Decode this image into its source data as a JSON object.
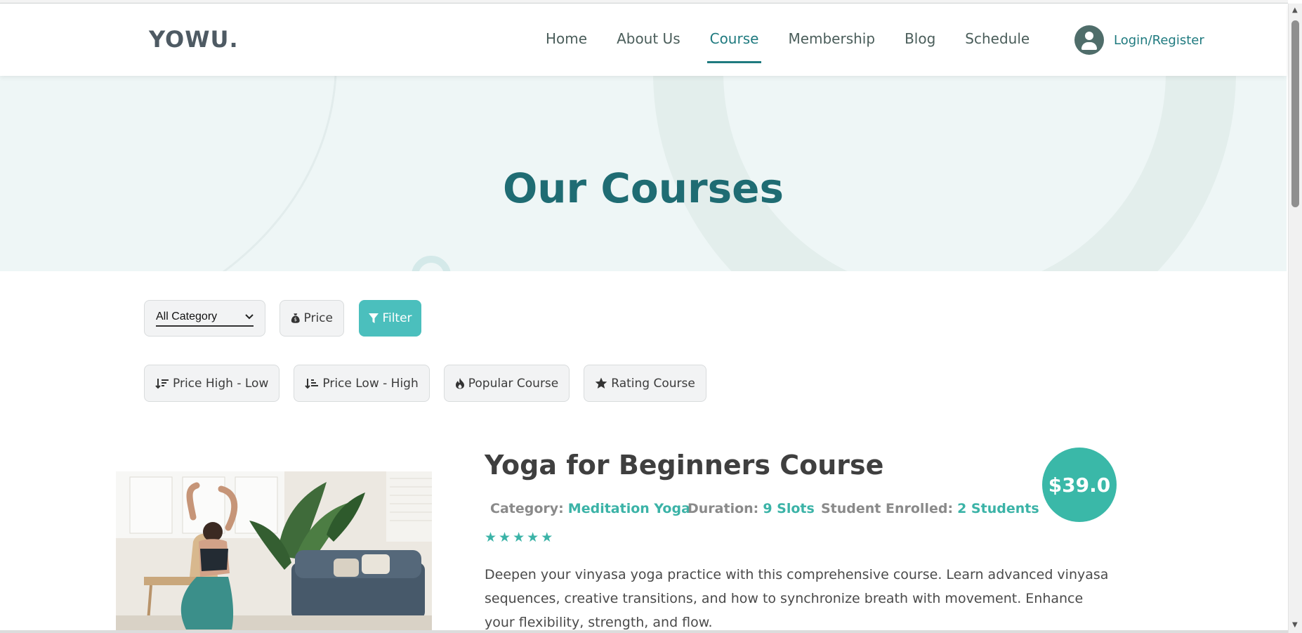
{
  "header": {
    "logo": "YOWU.",
    "nav": [
      {
        "label": "Home",
        "active": false
      },
      {
        "label": "About Us",
        "active": false
      },
      {
        "label": "Course",
        "active": true
      },
      {
        "label": "Membership",
        "active": false
      },
      {
        "label": "Blog",
        "active": false
      },
      {
        "label": "Schedule",
        "active": false
      }
    ],
    "login_label": "Login/Register"
  },
  "hero": {
    "title": "Our Courses"
  },
  "filters": {
    "category_selected": "All Category",
    "price_label": "Price",
    "filter_label": "Filter",
    "sort_options": [
      {
        "label": "Price High - Low",
        "icon": "sort-amount-down-icon"
      },
      {
        "label": "Price Low - High",
        "icon": "sort-amount-up-icon"
      },
      {
        "label": "Popular Course",
        "icon": "fire-icon"
      },
      {
        "label": "Rating Course",
        "icon": "star-icon"
      }
    ]
  },
  "course": {
    "title": "Yoga for Beginners Course",
    "category_key": "Category:",
    "category_value": "Meditation Yoga",
    "duration_key": "Duration:",
    "duration_value": "9 Slots",
    "enrolled_key": "Student Enrolled:",
    "enrolled_value": "2 Students",
    "rating": 5,
    "price": "$39.0",
    "description": "Deepen your vinyasa yoga practice with this comprehensive course. Learn advanced vinyasa sequences, creative transitions, and how to synchronize breath with movement. Enhance your flexibility, strength, and flow."
  },
  "colors": {
    "brand": "#1f7a7f",
    "accent": "#3bb3a7",
    "filter_button": "#4bbfbd",
    "hero_bg": "#eef6f6"
  }
}
